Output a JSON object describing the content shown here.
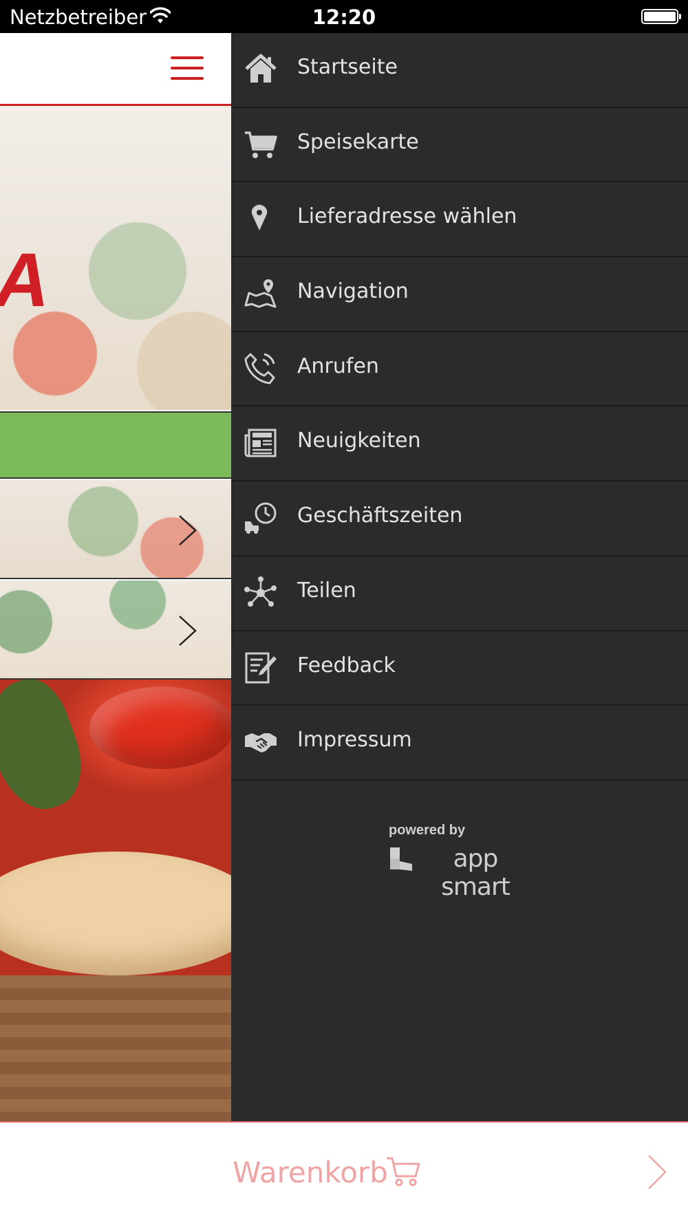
{
  "status_bar": {
    "carrier": "Netzbetreiber",
    "time": "12:20"
  },
  "drawer": {
    "items": [
      {
        "label": "Startseite",
        "icon": "home-icon"
      },
      {
        "label": "Speisekarte",
        "icon": "cart-icon"
      },
      {
        "label": "Lieferadresse wählen",
        "icon": "location-pin-icon"
      },
      {
        "label": "Navigation",
        "icon": "map-icon"
      },
      {
        "label": "Anrufen",
        "icon": "phone-icon"
      },
      {
        "label": "Neuigkeiten",
        "icon": "newspaper-icon"
      },
      {
        "label": "Geschäftszeiten",
        "icon": "delivery-clock-icon"
      },
      {
        "label": "Teilen",
        "icon": "share-icon"
      },
      {
        "label": "Feedback",
        "icon": "feedback-icon"
      },
      {
        "label": "Impressum",
        "icon": "handshake-icon"
      }
    ],
    "powered_by": "powered by",
    "brand": "app smart"
  },
  "hero": {
    "logo_fragment": "A"
  },
  "cart_bar": {
    "label": "Warenkorb"
  },
  "colors": {
    "accent_red": "#cc1f1f",
    "drawer_bg": "#2a2b2d",
    "green_bar": "#7dbb5a",
    "cart_text": "#f0a4a4"
  }
}
